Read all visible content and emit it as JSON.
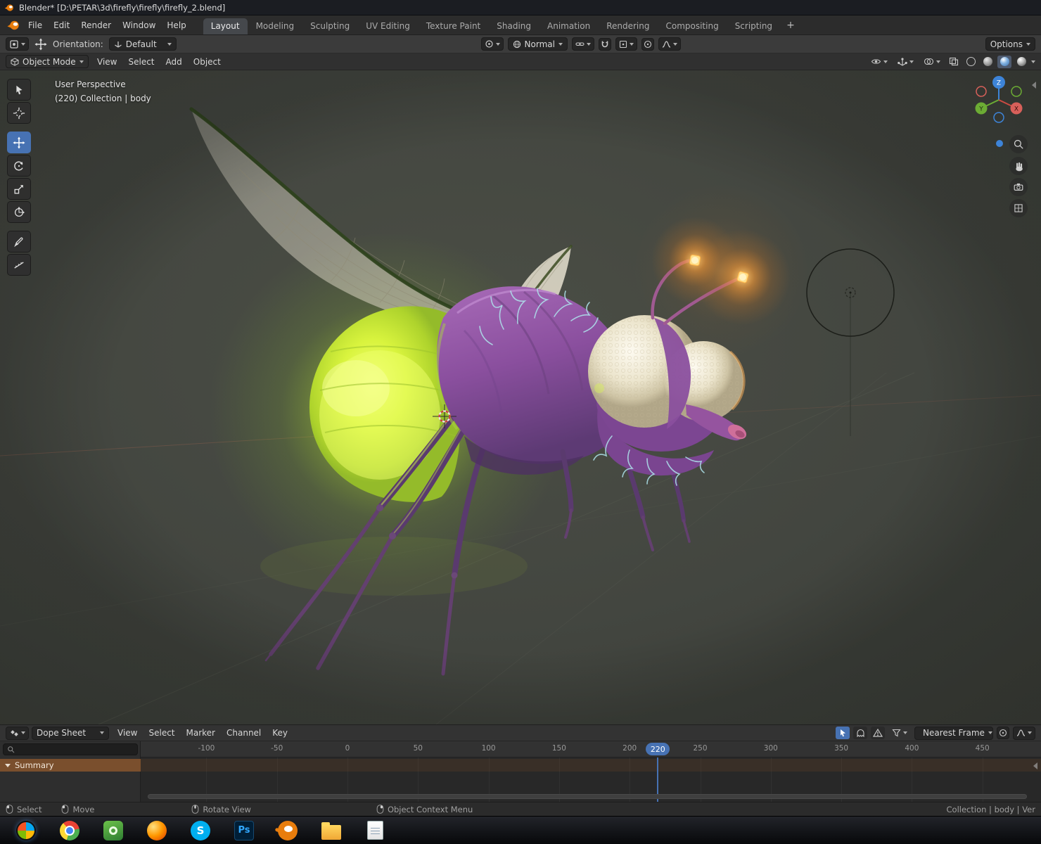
{
  "colors": {
    "accent": "#4772b3",
    "summary_row": "#7a4f2d",
    "glow_green": "#d8f542",
    "glow_orange": "#ffab40"
  },
  "title_bar": {
    "title": "Blender* [D:\\PETAR\\3d\\firefly\\firefly\\firefly_2.blend]"
  },
  "menu_bar": {
    "menus": [
      "File",
      "Edit",
      "Render",
      "Window",
      "Help"
    ],
    "workspaces": [
      "Layout",
      "Modeling",
      "Sculpting",
      "UV Editing",
      "Texture Paint",
      "Shading",
      "Animation",
      "Rendering",
      "Compositing",
      "Scripting"
    ],
    "active_workspace": "Layout",
    "new_workspace_button": "+"
  },
  "tool_header": {
    "orientation_label": "Orientation:",
    "orientation_value": "Default",
    "transform_orientation": "Normal",
    "options_button": "Options"
  },
  "viewport_header": {
    "mode_select": "Object Mode",
    "menus": [
      "View",
      "Select",
      "Add",
      "Object"
    ]
  },
  "viewport": {
    "view_label": "User Perspective",
    "collection_label": "(220) Collection | body",
    "gizmo_axes": {
      "x": "X",
      "y": "Y",
      "z": "Z"
    }
  },
  "dope_sheet": {
    "editor_select": "Dope Sheet",
    "menus": [
      "View",
      "Select",
      "Marker",
      "Channel",
      "Key"
    ],
    "snap_select": "Nearest Frame",
    "summary_label": "Summary",
    "timeline": {
      "ticks": [
        -100,
        -50,
        0,
        50,
        100,
        150,
        200,
        250,
        300,
        350,
        400,
        450
      ],
      "current_frame": 220
    }
  },
  "status_bar": {
    "hints": [
      {
        "button": "left",
        "label": "Select"
      },
      {
        "button": "left",
        "label": "Move"
      },
      {
        "button": "middle",
        "label": "Rotate View"
      },
      {
        "button": "right",
        "label": "Object Context Menu"
      }
    ],
    "right_text": "Collection | body | Ver"
  },
  "taskbar": {
    "apps": [
      {
        "name": "start"
      },
      {
        "name": "chrome"
      },
      {
        "name": "green-app"
      },
      {
        "name": "firefox"
      },
      {
        "name": "skype",
        "glyph": "S"
      },
      {
        "name": "photoshop",
        "glyph": "Ps"
      },
      {
        "name": "blender"
      },
      {
        "name": "file-explorer"
      },
      {
        "name": "notes"
      }
    ]
  }
}
